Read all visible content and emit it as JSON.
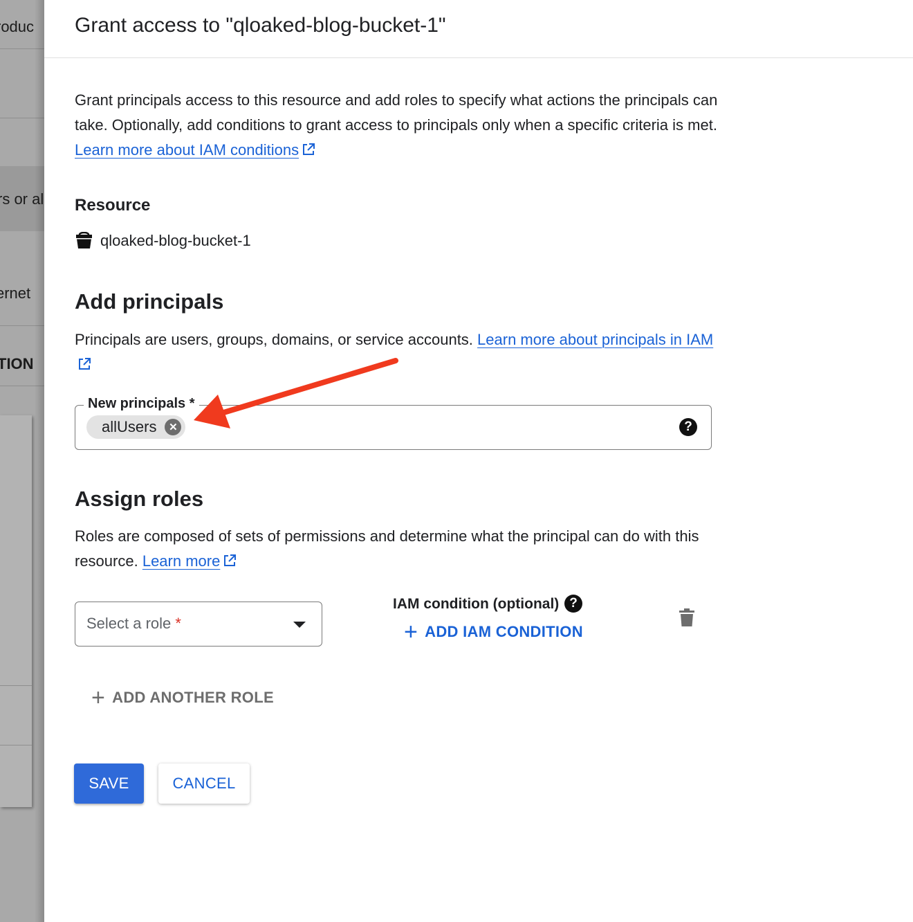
{
  "background": {
    "fragments": [
      "roduc",
      "rs or al",
      "ernet",
      "TION"
    ]
  },
  "dialog": {
    "title": "Grant access to \"qloaked-blog-bucket-1\"",
    "intro_text": "Grant principals access to this resource and add roles to specify what actions the principals can take. Optionally, add conditions to grant access to principals only when a specific criteria is met. ",
    "intro_link": "Learn more about IAM conditions"
  },
  "resource": {
    "label": "Resource",
    "name": "qloaked-blog-bucket-1",
    "icon": "bucket-icon"
  },
  "principals": {
    "heading": "Add principals",
    "description": "Principals are users, groups, domains, or service accounts. ",
    "link": "Learn more about principals in IAM",
    "field_label": "New principals *",
    "chips": [
      "allUsers"
    ]
  },
  "roles": {
    "heading": "Assign roles",
    "description": "Roles are composed of sets of permissions and determine what the principal can do with this resource. ",
    "link": "Learn more",
    "select_placeholder": "Select a role",
    "required_mark": "*",
    "condition_label": "IAM condition (optional)",
    "add_condition": "ADD IAM CONDITION",
    "add_another_role": "ADD ANOTHER ROLE"
  },
  "actions": {
    "save": "SAVE",
    "cancel": "CANCEL"
  },
  "annotation": {
    "arrow_color": "#f03a1e"
  },
  "colors": {
    "link": "#1a62d6",
    "primary_button": "#2f6ad9"
  }
}
